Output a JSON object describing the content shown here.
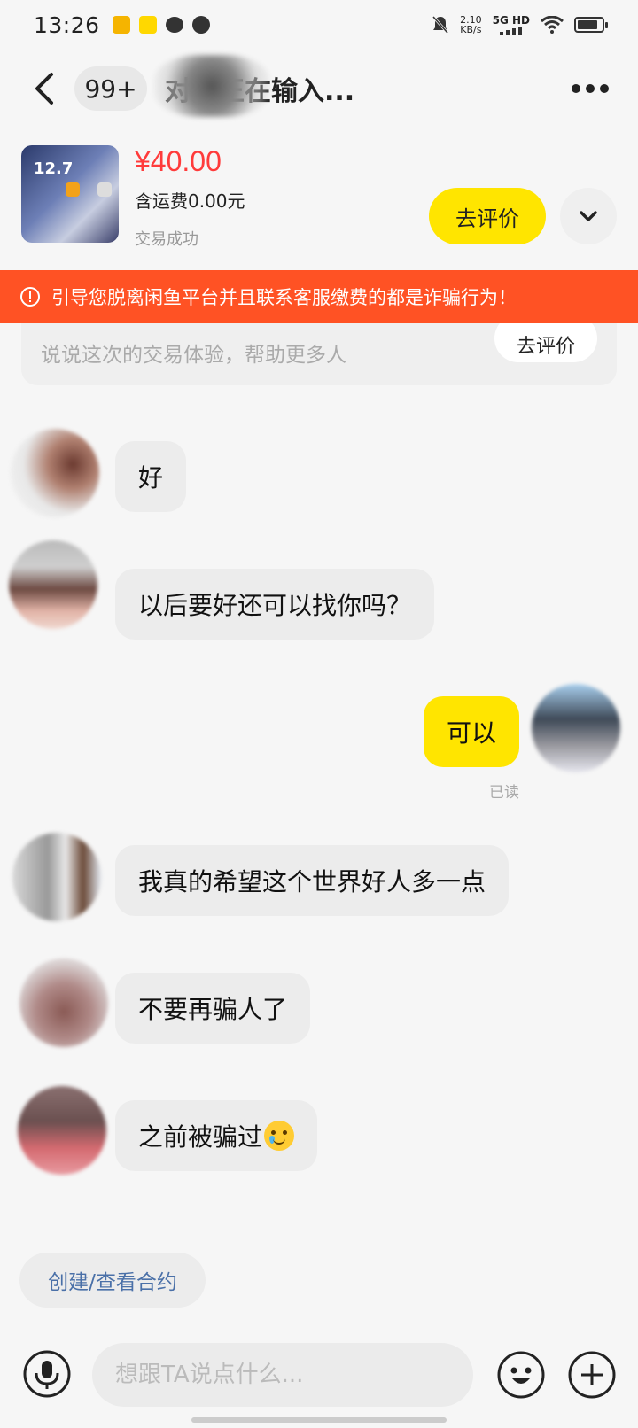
{
  "status_bar": {
    "time": "13:26",
    "net_speed": "2.10",
    "net_unit": "KB/s",
    "signal": "5G HD"
  },
  "header": {
    "unread_badge": "99+",
    "title": "对方正在输入..."
  },
  "product": {
    "price": "¥40.00",
    "shipping": "含运费0.00元",
    "status": "交易成功",
    "thumb_text": "12.7",
    "review_button": "去评价"
  },
  "warning": {
    "text": "引导您脱离闲鱼平台并且联系客服缴费的都是诈骗行为！"
  },
  "review_card": {
    "hint": "说说这次的交易体验，帮助更多人",
    "button": "去评价"
  },
  "messages": [
    {
      "from": "other",
      "text": "好"
    },
    {
      "from": "other",
      "text": "以后要好还可以找你吗？"
    },
    {
      "from": "me",
      "text": "可以",
      "status": "已读"
    },
    {
      "from": "other",
      "text": "我真的希望这个世界好人多一点"
    },
    {
      "from": "other",
      "text": "不要再骗人了"
    },
    {
      "from": "other",
      "text": "之前被骗过",
      "emoji": "crying-smile-emoji"
    }
  ],
  "contract_button": "创建/查看合约",
  "composer": {
    "placeholder": "想跟TA说点什么..."
  },
  "colors": {
    "brand_yellow": "#ffe500",
    "warning_red": "#ff5224",
    "price_red": "#ff3b3b",
    "link_blue": "#4a70a8"
  }
}
